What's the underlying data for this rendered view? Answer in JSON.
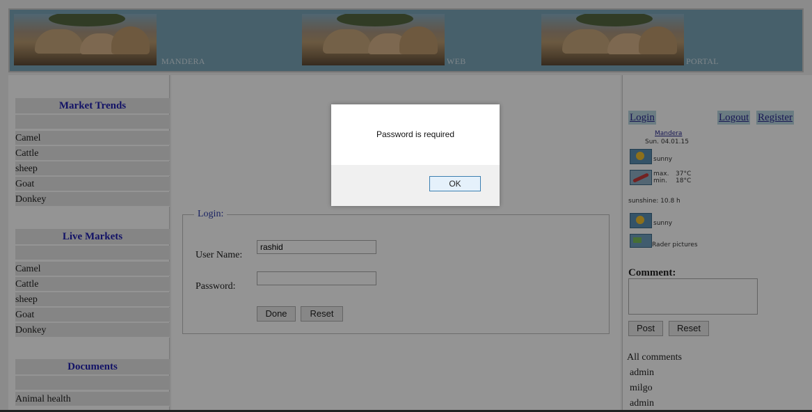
{
  "banner": {
    "words": [
      "MANDERA",
      "WEB",
      "PORTAL"
    ]
  },
  "sidebar": {
    "market_trends": {
      "title": "Market Trends",
      "items": [
        "Camel",
        "Cattle",
        "sheep",
        "Goat",
        "Donkey"
      ]
    },
    "live_markets": {
      "title": "Live Markets",
      "items": [
        "Camel",
        "Cattle",
        "sheep",
        "Goat",
        "Donkey"
      ]
    },
    "documents": {
      "title": "Documents",
      "items": [
        "Animal health"
      ]
    }
  },
  "login_form": {
    "legend": "Login:",
    "username_label": "User Name:",
    "username_value": "rashid",
    "password_label": "Password:",
    "password_value": "",
    "done_label": "Done",
    "reset_label": "Reset"
  },
  "account": {
    "login_label": "Login",
    "logout_label": "Logout",
    "register_label": "Register"
  },
  "weather": {
    "location": "Mandera",
    "date": "Sun. 04.01.15",
    "condition1": "sunny",
    "max_label": "max.",
    "max_value": "37°C",
    "min_label": "min.",
    "min_value": "18°C",
    "sunshine": "sunshine: 10.8 h",
    "condition2": "sunny",
    "radar": "Rader pictures"
  },
  "comments": {
    "title": "Comment:",
    "post_label": "Post",
    "reset_label": "Reset",
    "all_label": "All comments",
    "list": [
      "admin",
      "milgo",
      "admin"
    ]
  },
  "dialog": {
    "message": "Password is required",
    "ok_label": "OK"
  }
}
